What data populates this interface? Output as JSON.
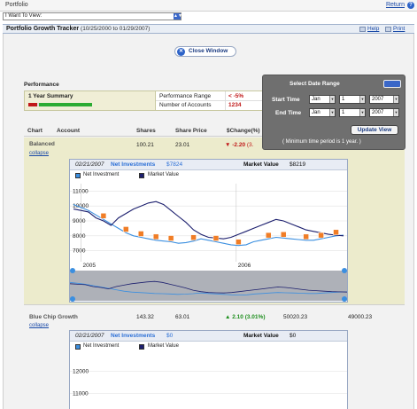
{
  "window": {
    "title": "Portfolio",
    "return_link": "Return"
  },
  "i_want_to": {
    "value": "I Want To View:"
  },
  "tracker": {
    "title": "Portfolio Growth Tracker",
    "date_range": "(10/25/2000 to 01/29/2007)",
    "help": "Help",
    "print": "Print"
  },
  "close_window": "Close Window",
  "performance": {
    "label": "Performance",
    "summary_label": "1 Year Summary",
    "range_label": "Performance Range",
    "range_value": "< -5%",
    "accounts_label": "Number of Accounts",
    "accounts_value": "1234",
    "bar_red_fraction": 0.14,
    "bar_green_fraction": 0.83
  },
  "table_headers": {
    "chart": "Chart",
    "account": "Account",
    "shares": "Shares",
    "share_price": "Share Price",
    "change": "$Change(%)"
  },
  "funds": [
    {
      "name": "Balanced",
      "collapse": "collapse",
      "shares": "100.21",
      "share_price": "23.01",
      "change": "-2.20",
      "change_pct": "(3.",
      "chart": {
        "date": "02/21/2007",
        "net_investment_label": "Net Investments",
        "net_investment_value": "$7824",
        "market_value_label": "Market Value",
        "market_value_value": "$8219",
        "legend_net": "Net Investment",
        "legend_market": "Market Value"
      }
    },
    {
      "name": "Blue Chip Growth",
      "collapse": "collapse",
      "shares": "143.32",
      "share_price": "63.01",
      "change": "2.10",
      "change_pct": "(3.01%)",
      "col5": "50020.23",
      "col6": "49000.23",
      "chart": {
        "date": "02/21/2007",
        "net_investment_label": "Net Investments",
        "net_investment_value": "$0",
        "market_value_label": "Market Value",
        "market_value_value": "$0",
        "legend_net": "Net Investment",
        "legend_market": "Market Value"
      }
    }
  ],
  "date_popup": {
    "title": "Select Date Range",
    "start_label": "Start Time",
    "end_label": "End Time",
    "start_month": "Jan",
    "start_day": "1",
    "start_year": "2007",
    "end_month": "Jan",
    "end_day": "1",
    "end_year": "2007",
    "update_button": "Update View",
    "note": "( Minimum time period is 1 year. )"
  },
  "colors": {
    "net_investment": "#3b8fe0",
    "market_value": "#1c1f6e",
    "marker": "#f07d26",
    "negative": "#c01818",
    "positive": "#1e8f1e"
  },
  "chart_data": [
    {
      "type": "line",
      "y_ticks": [
        "11000",
        "10000",
        "9000",
        "8000",
        "7000"
      ],
      "x_ticks": [
        "2005",
        "2006"
      ],
      "ylim": [
        6500,
        11500
      ],
      "series": [
        {
          "name": "Net Investment",
          "values": [
            10100,
            9900,
            9700,
            9400,
            9100,
            8800,
            8500,
            8200,
            8000,
            7900,
            7800,
            7700,
            7650,
            7600,
            7500,
            7550,
            7650,
            7800,
            7700,
            7600,
            7500,
            7400,
            7350,
            7400,
            7600,
            7700,
            7800,
            7900,
            7850,
            7800,
            7750,
            7700,
            7700,
            7800,
            7900,
            8000,
            8050
          ]
        },
        {
          "name": "Market Value",
          "values": [
            9800,
            9700,
            9600,
            9200,
            9000,
            8700,
            9200,
            9500,
            9800,
            10000,
            10200,
            10300,
            10100,
            9700,
            9300,
            8900,
            8400,
            8100,
            7900,
            7850,
            7800,
            7900,
            8100,
            8300,
            8500,
            8700,
            8900,
            9100,
            9000,
            8800,
            8600,
            8400,
            8300,
            8200,
            8100,
            8050,
            8000
          ]
        }
      ]
    },
    {
      "type": "line",
      "y_ticks": [
        "12000",
        "11000"
      ],
      "ylim": [
        10500,
        12500
      ],
      "series": []
    }
  ]
}
